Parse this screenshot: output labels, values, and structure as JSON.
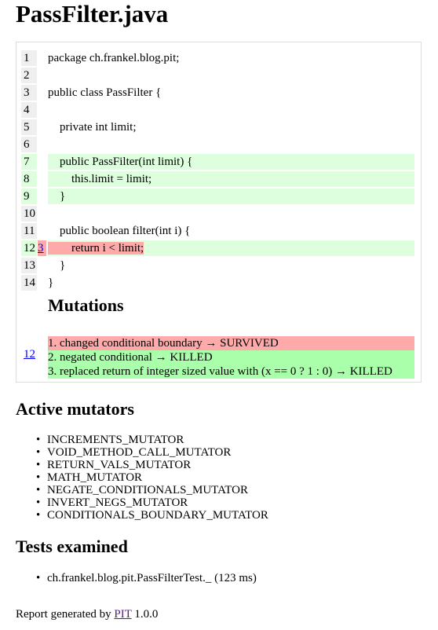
{
  "page_title": "PassFilter.java",
  "source": {
    "lines": [
      {
        "number": "1",
        "code": "package ch.frankel.blog.pit;",
        "covered": false,
        "mutations": ""
      },
      {
        "number": "2",
        "code": "",
        "covered": false,
        "mutations": ""
      },
      {
        "number": "3",
        "code": "public class PassFilter {",
        "covered": false,
        "mutations": ""
      },
      {
        "number": "4",
        "code": "",
        "covered": false,
        "mutations": ""
      },
      {
        "number": "5",
        "code": "    private int limit;",
        "covered": false,
        "mutations": ""
      },
      {
        "number": "6",
        "code": "",
        "covered": false,
        "mutations": ""
      },
      {
        "number": "7",
        "code": "    public PassFilter(int limit) {",
        "covered": true,
        "mutations": ""
      },
      {
        "number": "8",
        "code": "        this.limit = limit;",
        "covered": true,
        "mutations": ""
      },
      {
        "number": "9",
        "code": "    }",
        "covered": true,
        "mutations": ""
      },
      {
        "number": "10",
        "code": "",
        "covered": false,
        "mutations": ""
      },
      {
        "number": "11",
        "code": "    public boolean filter(int i) {",
        "covered": false,
        "mutations": ""
      },
      {
        "number": "12",
        "code": "        return i < limit;",
        "covered": true,
        "mutations": "3",
        "survived": true
      },
      {
        "number": "13",
        "code": "    }",
        "covered": false,
        "mutations": ""
      },
      {
        "number": "14",
        "code": "}",
        "covered": false,
        "mutations": ""
      }
    ]
  },
  "mutations": {
    "heading": "Mutations",
    "line_link": "12",
    "items": [
      {
        "text": "1. changed conditional boundary → SURVIVED",
        "status": "SURVIVED"
      },
      {
        "text": "2. negated conditional → KILLED",
        "status": "KILLED"
      },
      {
        "text": "3. replaced return of integer sized value with (x == 0 ? 1 : 0) → KILLED",
        "status": "KILLED"
      }
    ]
  },
  "active_mutators": {
    "heading": "Active mutators",
    "items": [
      "INCREMENTS_MUTATOR",
      "VOID_METHOD_CALL_MUTATOR",
      "RETURN_VALS_MUTATOR",
      "MATH_MUTATOR",
      "NEGATE_CONDITIONALS_MUTATOR",
      "INVERT_NEGS_MUTATOR",
      "CONDITIONALS_BOUNDARY_MUTATOR"
    ]
  },
  "tests_examined": {
    "heading": "Tests examined",
    "items": [
      "ch.frankel.blog.pit.PassFilterTest._ (123 ms)"
    ]
  },
  "footer": {
    "prefix": "Report generated by ",
    "link": "PIT",
    "suffix": " 1.0.0"
  },
  "colors": {
    "covered": "#ddffdd",
    "survived": "#ffaaaa",
    "killed": "#aaffaa",
    "line_number_bg": "#efefef",
    "link": "#0000ee"
  }
}
